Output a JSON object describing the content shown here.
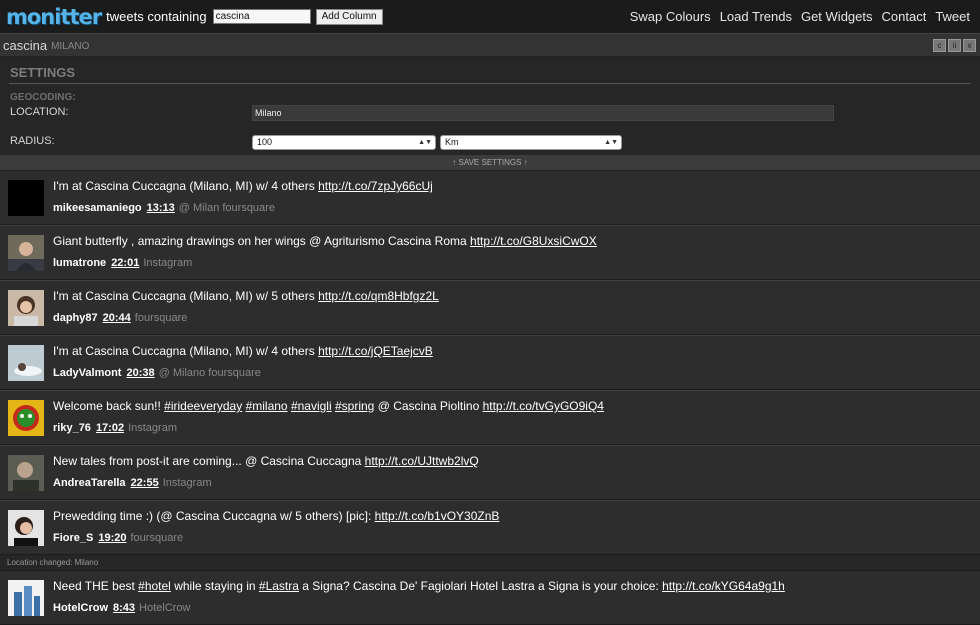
{
  "app": {
    "logo": "monitter",
    "search_prefix": "tweets containing",
    "search_value": "cascina",
    "add_column_label": "Add Column",
    "nav": [
      "Swap Colours",
      "Load Trends",
      "Get Widgets",
      "Contact",
      "Tweet"
    ]
  },
  "column": {
    "title": "cascina",
    "subtitle": "MILANO",
    "buttons": [
      "c",
      "ii",
      "x"
    ]
  },
  "settings": {
    "title": "SETTINGS",
    "geocoding_label": "GEOCODING:",
    "location_label": "LOCATION:",
    "location_value": "Milano",
    "radius_label": "RADIUS:",
    "radius_value": "100",
    "unit_value": "Km",
    "save_label": "↑ SAVE SETTINGS ↑"
  },
  "tweets": [
    {
      "text": "I'm at Cascina Cuccagna (Milano, MI) w/ 4 others",
      "link": "http://t.co/7zpJy66cUj",
      "user": "mikeesamaniego",
      "time": "13:13",
      "source": "@ Milan foursquare"
    },
    {
      "text": "Giant butterfly , amazing drawings on her wings @ Agriturismo Cascina Roma",
      "link": "http://t.co/G8UxsiCwOX",
      "user": "lumatrone",
      "time": "22:01",
      "source": "Instagram"
    },
    {
      "text": "I'm at Cascina Cuccagna (Milano, MI) w/ 5 others",
      "link": "http://t.co/qm8Hbfgz2L",
      "user": "daphy87",
      "time": "20:44",
      "source": "foursquare"
    },
    {
      "text": "I'm at Cascina Cuccagna (Milano, MI) w/ 4 others",
      "link": "http://t.co/jQETaejcvB",
      "user": "LadyValmont",
      "time": "20:38",
      "source": "@ Milano foursquare"
    },
    {
      "pre": "Welcome back sun!! ",
      "tags": [
        "#irideeveryday",
        "#milano",
        "#navigli",
        "#spring"
      ],
      "text": "@ Cascina Pioltino",
      "link": "http://t.co/tvGyGO9iQ4",
      "user": "riky_76",
      "time": "17:02",
      "source": "Instagram"
    },
    {
      "text": "New tales from post-it are coming... @ Cascina Cuccagna",
      "link": "http://t.co/UJttwb2lvQ",
      "user": "AndreaTarella",
      "time": "22:55",
      "source": "Instagram"
    },
    {
      "text": "Prewedding time :) (@ Cascina Cuccagna w/ 5 others) [pic]:",
      "link": "http://t.co/b1vOY30ZnB",
      "user": "Fiore_S",
      "time": "19:20",
      "source": "foursquare"
    }
  ],
  "notice": "Location changed: Milano",
  "last_tweet": {
    "pre": "Need THE best ",
    "tag1": "#hotel",
    "mid": " while staying in ",
    "tag2": "#Lastra",
    "post": " a Signa? Cascina De' Fagiolari Hotel Lastra a Signa is your choice:",
    "link": "http://t.co/kYG64a9g1h",
    "user": "HotelCrow",
    "time": "8:43",
    "source": "HotelCrow"
  }
}
